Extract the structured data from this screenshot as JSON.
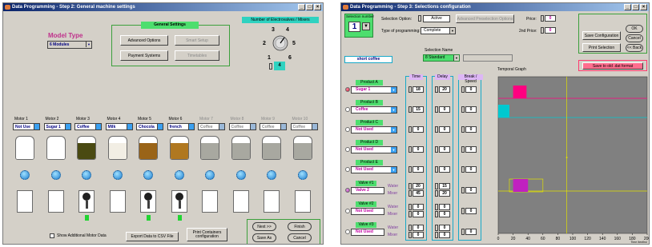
{
  "window1": {
    "title": "Data Programming - Step 2: General machine settings",
    "model_type_label": "Model Type",
    "model_type_value": "6 Modules",
    "general_settings_title": "General Settings",
    "advanced_options": "Advanced Options",
    "smart_setup": "Smart Setup",
    "payment_systems": "Payment Systems",
    "timetables": "Timetables",
    "electrovalves_label": "Number of Electrovalves / Mixers",
    "dial_numbers": [
      "1",
      "2",
      "3",
      "4",
      "5",
      "6"
    ],
    "dial_value": "4",
    "motors": [
      {
        "label": "Motor 1",
        "value": "Not Use",
        "fill": "#ffffff",
        "enabled": true,
        "indicator": false,
        "valve": false
      },
      {
        "label": "Motor 2",
        "value": "Sugar 1",
        "fill": "#ffffff",
        "enabled": true,
        "indicator": false,
        "valve": false
      },
      {
        "label": "Motor 3",
        "value": "Coffee",
        "fill": "#4a4a12",
        "enabled": true,
        "indicator": true,
        "valve": true
      },
      {
        "label": "Motor 4",
        "value": "Milk",
        "fill": "#f2eee4",
        "enabled": true,
        "indicator": false,
        "valve": false
      },
      {
        "label": "Motor 5",
        "value": "Chocola",
        "fill": "#9a6418",
        "enabled": true,
        "indicator": true,
        "valve": true
      },
      {
        "label": "Motor 6",
        "value": "french",
        "fill": "#b07820",
        "enabled": true,
        "indicator": true,
        "valve": true
      },
      {
        "label": "Motor 7",
        "value": "Coffee",
        "fill": "#a8a8a0",
        "enabled": false,
        "indicator": false,
        "valve": false
      },
      {
        "label": "Motor 8",
        "value": "Coffee",
        "fill": "#a8a8a0",
        "enabled": false,
        "indicator": false,
        "valve": false
      },
      {
        "label": "Motor 9",
        "value": "Coffee",
        "fill": "#a8a8a0",
        "enabled": false,
        "indicator": false,
        "valve": false
      },
      {
        "label": "Motor 10",
        "value": "Coffee",
        "fill": "#a8a8a0",
        "enabled": false,
        "indicator": false,
        "valve": false
      }
    ],
    "show_additional": "Show Additional Motor Data",
    "export_csv": "Export Data to CSV File",
    "print_containers": "Print Containers configuration",
    "next": "Next >>",
    "finish": "Finish",
    "save_as": "Save As",
    "cancel": "Cancel"
  },
  "window2": {
    "title": "Data Programming - Step 3: Selections configuration",
    "selection_number_label": "Selection number",
    "selection_number": "1",
    "selection_option_label": "Selection Option:",
    "selection_option_value": "Active",
    "advanced_preselection": "Advanced Preselection Options",
    "price_label": "Price:",
    "price_value": "0",
    "price2_label": "2nd Price:",
    "price2_value": "0",
    "type_label": "Type of programming:",
    "type_value": "Complete",
    "selection_name_label": "Selection Name",
    "selection_name_value": "8 Standard",
    "product_name": "short coffee",
    "save_configuration": "Save Configuration",
    "print_selection": "Print Selection",
    "ok": "OK",
    "cancel": "Cancel",
    "back": "<< Back",
    "save_old_format": "Save to old .dat format",
    "temporal_graph": "Temporal Graph",
    "col_time": "Time",
    "col_delay": "Delay",
    "col_break": "Break / Speed",
    "products": [
      {
        "label": "Product A",
        "value": "Sugar 1",
        "time": "18",
        "delay": "20",
        "brk": "0",
        "radio": "on"
      },
      {
        "label": "Product B",
        "value": "Coffee",
        "time": "15",
        "delay": "0",
        "brk": "0",
        "radio": "off"
      },
      {
        "label": "Product C",
        "value": "Not Used",
        "time": "0",
        "delay": "0",
        "brk": "0",
        "radio": "off"
      },
      {
        "label": "Product D",
        "value": "Not Used",
        "time": "0",
        "delay": "0",
        "brk": "0",
        "radio": "off"
      },
      {
        "label": "Product E",
        "value": "Not Used",
        "time": "0",
        "delay": "0",
        "brk": "0",
        "radio": "off"
      }
    ],
    "valves": [
      {
        "label": "Valve #1",
        "value": "Valve 2",
        "water_time": "20",
        "mixer_time": "45",
        "water_delay": "15",
        "mixer_delay": "20",
        "brk": "0",
        "radio": "onp"
      },
      {
        "label": "Valve #2",
        "value": "Not Used",
        "water_time": "0",
        "mixer_time": "0",
        "water_delay": "0",
        "mixer_delay": "0",
        "brk": "0",
        "radio": "off"
      },
      {
        "label": "Valve #3",
        "value": "Not Used",
        "water_time": "0",
        "mixer_time": "0",
        "water_delay": "0",
        "mixer_delay": "0",
        "brk": "0",
        "radio": "off"
      }
    ],
    "water_label": "Water",
    "mixer_label": "Mixer",
    "graph_ticks": [
      "0",
      "20",
      "40",
      "60",
      "80",
      "100",
      "120",
      "140",
      "160",
      "180",
      "200"
    ],
    "graph_xlabel": "Time (tenths)",
    "colors": {
      "accent_pink": "#ff0080",
      "accent_cyan": "#00c8d0",
      "accent_purple": "#c020c0",
      "graph_bg": "#808080"
    }
  }
}
